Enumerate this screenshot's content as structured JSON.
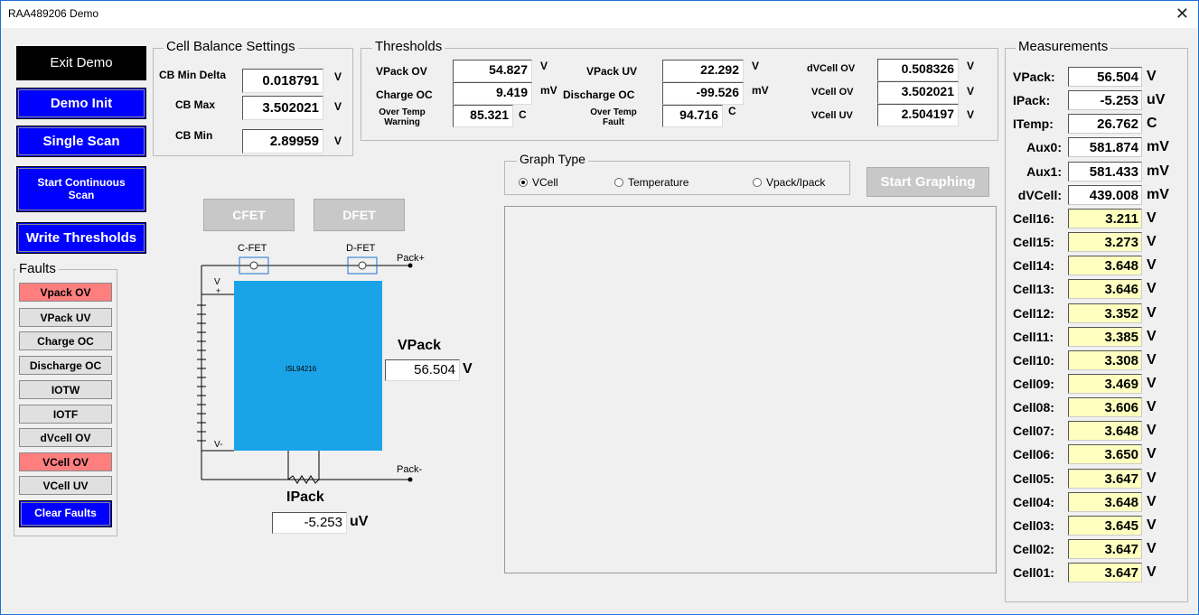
{
  "window": {
    "title": "RAA489206 Demo",
    "close_glyph": "✕"
  },
  "buttons": {
    "exit_demo": "Exit Demo",
    "demo_init": "Demo Init",
    "single_scan": "Single Scan",
    "start_continuous_scan": "Start Continuous Scan",
    "write_thresholds": "Write Thresholds",
    "clear_faults": "Clear Faults",
    "cfet": "CFET",
    "dfet": "DFET",
    "start_graphing": "Start Graphing"
  },
  "cell_balance": {
    "legend": "Cell Balance Settings",
    "cb_min_delta": {
      "label": "CB Min Delta",
      "value": "0.018791",
      "unit": "V"
    },
    "cb_max": {
      "label": "CB Max",
      "value": "3.502021",
      "unit": "V"
    },
    "cb_min": {
      "label": "CB Min",
      "value": "2.89959",
      "unit": "V"
    }
  },
  "thresholds": {
    "legend": "Thresholds",
    "vpack_ov": {
      "label": "VPack OV",
      "value": "54.827",
      "unit": "V"
    },
    "charge_oc": {
      "label": "Charge OC",
      "value": "9.419",
      "unit": "mV"
    },
    "over_temp_warning": {
      "label": "Over Temp Warning",
      "value": "85.321",
      "unit": "C"
    },
    "vpack_uv": {
      "label": "VPack UV",
      "value": "22.292",
      "unit": "V"
    },
    "discharge_oc": {
      "label": "Discharge OC",
      "value": "-99.526",
      "unit": "mV"
    },
    "over_temp_fault": {
      "label": "Over Temp Fault",
      "value": "94.716",
      "unit": "C"
    },
    "dvcell_ov": {
      "label": "dVCell OV",
      "value": "0.508326",
      "unit": "V"
    },
    "vcell_ov": {
      "label": "VCell OV",
      "value": "3.502021",
      "unit": "V"
    },
    "vcell_uv": {
      "label": "VCell UV",
      "value": "2.504197",
      "unit": "V"
    }
  },
  "faults": {
    "legend": "Faults",
    "items": [
      {
        "label": "Vpack OV",
        "active": true
      },
      {
        "label": "VPack UV",
        "active": false
      },
      {
        "label": "Charge OC",
        "active": false
      },
      {
        "label": "Discharge OC",
        "active": false
      },
      {
        "label": "IOTW",
        "active": false
      },
      {
        "label": "IOTF",
        "active": false
      },
      {
        "label": "dVcell OV",
        "active": false
      },
      {
        "label": "VCell OV",
        "active": true
      },
      {
        "label": "VCell UV",
        "active": false
      }
    ],
    "active_color": "#ff7f7f"
  },
  "circuit": {
    "c_fet": "C-FET",
    "d_fet": "D-FET",
    "pack_plus": "Pack+",
    "pack_minus": "Pack-",
    "v_plus": "V",
    "v_plus_sign": "+",
    "v_minus": "V-",
    "chip": "ISL94216",
    "chip_color": "#1aa3e6",
    "vpack_label": "VPack",
    "vpack_value": "56.504",
    "vpack_unit": "V",
    "ipack_label": "IPack",
    "ipack_value": "-5.253",
    "ipack_unit": "uV"
  },
  "graph": {
    "legend": "Graph Type",
    "options": [
      {
        "label": "VCell",
        "selected": true
      },
      {
        "label": "Temperature",
        "selected": false
      },
      {
        "label": "Vpack/Ipack",
        "selected": false
      }
    ]
  },
  "measurements": {
    "legend": "Measurements",
    "rows": [
      {
        "label": "VPack:",
        "value": "56.504",
        "unit": "V",
        "highlight": false
      },
      {
        "label": "IPack:",
        "value": "-5.253",
        "unit": "uV",
        "highlight": false
      },
      {
        "label": "ITemp:",
        "value": "26.762",
        "unit": "C",
        "highlight": false
      },
      {
        "label": "Aux0:",
        "value": "581.874",
        "unit": "mV",
        "highlight": false
      },
      {
        "label": "Aux1:",
        "value": "581.433",
        "unit": "mV",
        "highlight": false
      },
      {
        "label": "dVCell:",
        "value": "439.008",
        "unit": "mV",
        "highlight": false
      },
      {
        "label": "Cell16:",
        "value": "3.211",
        "unit": "V",
        "highlight": true
      },
      {
        "label": "Cell15:",
        "value": "3.273",
        "unit": "V",
        "highlight": true
      },
      {
        "label": "Cell14:",
        "value": "3.648",
        "unit": "V",
        "highlight": true
      },
      {
        "label": "Cell13:",
        "value": "3.646",
        "unit": "V",
        "highlight": true
      },
      {
        "label": "Cell12:",
        "value": "3.352",
        "unit": "V",
        "highlight": true
      },
      {
        "label": "Cell11:",
        "value": "3.385",
        "unit": "V",
        "highlight": true
      },
      {
        "label": "Cell10:",
        "value": "3.308",
        "unit": "V",
        "highlight": true
      },
      {
        "label": "Cell09:",
        "value": "3.469",
        "unit": "V",
        "highlight": true
      },
      {
        "label": "Cell08:",
        "value": "3.606",
        "unit": "V",
        "highlight": true
      },
      {
        "label": "Cell07:",
        "value": "3.648",
        "unit": "V",
        "highlight": true
      },
      {
        "label": "Cell06:",
        "value": "3.650",
        "unit": "V",
        "highlight": true
      },
      {
        "label": "Cell05:",
        "value": "3.647",
        "unit": "V",
        "highlight": true
      },
      {
        "label": "Cell04:",
        "value": "3.648",
        "unit": "V",
        "highlight": true
      },
      {
        "label": "Cell03:",
        "value": "3.645",
        "unit": "V",
        "highlight": true
      },
      {
        "label": "Cell02:",
        "value": "3.647",
        "unit": "V",
        "highlight": true
      },
      {
        "label": "Cell01:",
        "value": "3.647",
        "unit": "V",
        "highlight": true
      }
    ],
    "highlight_color": "#ffffc0"
  }
}
